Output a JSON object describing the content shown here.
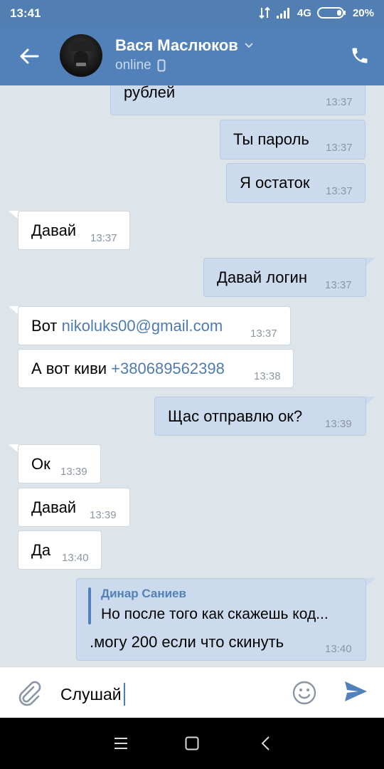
{
  "status_bar": {
    "time": "13:41",
    "network": "4G",
    "battery": "20%"
  },
  "header": {
    "name": "Вася Маслюков",
    "status": "online"
  },
  "messages": [
    {
      "dir": "out",
      "text": "рублей",
      "time": "13:37"
    },
    {
      "dir": "out",
      "text": "Ты пароль",
      "time": "13:37"
    },
    {
      "dir": "out",
      "text": "Я остаток",
      "time": "13:37"
    },
    {
      "dir": "in",
      "text": "Давай",
      "time": "13:37"
    },
    {
      "dir": "out",
      "text": "Давай логин",
      "time": "13:37"
    },
    {
      "dir": "in",
      "prefix": "Вот ",
      "link": "nikoluks00@gmail.com",
      "time": "13:37"
    },
    {
      "dir": "in",
      "prefix": "А вот киви ",
      "link": "+380689562398",
      "time": "13:38"
    },
    {
      "dir": "out",
      "text": "Щас отправлю ок?",
      "time": "13:39"
    },
    {
      "dir": "in",
      "text": "Ок",
      "time": "13:39"
    },
    {
      "dir": "in",
      "text": "Давай",
      "time": "13:39"
    },
    {
      "dir": "in",
      "text": "Да",
      "time": "13:40"
    },
    {
      "dir": "out",
      "reply_author": "Динар Саниев",
      "reply_text": "Но после того как скажешь код...",
      "text": ".могу 200 если что скинуть",
      "time": "13:40"
    }
  ],
  "composer": {
    "value": "Слушай"
  },
  "colors": {
    "header": "#5181b8",
    "outgoing_bubble": "#cbdbed",
    "incoming_bubble": "#ffffff",
    "chat_background": "#dde4ea",
    "link": "#4e7cb0"
  }
}
